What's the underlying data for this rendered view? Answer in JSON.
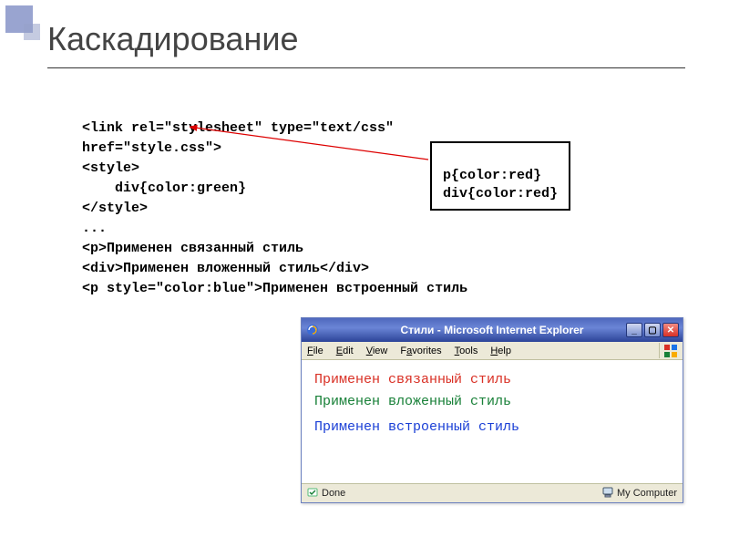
{
  "slide": {
    "title": "Каскадирование"
  },
  "code": {
    "l1": "<link rel=\"stylesheet\" type=\"text/css\"",
    "l2": "href=\"style.css\">",
    "l3": "<style>",
    "l4": "    div{color:green}",
    "l5": "</style>",
    "l6": "...",
    "l7": "<p>Применен связанный стиль",
    "l8": "<div>Применен вложенный стиль</div>",
    "l9": "<p style=\"color:blue\">Применен встроенный стиль"
  },
  "cssbox": {
    "l1": "p{color:red}",
    "l2": "div{color:red}"
  },
  "iewin": {
    "title": "Стили - Microsoft Internet Explorer",
    "menu": {
      "file": "File",
      "edit": "Edit",
      "view": "View",
      "favorites": "Favorites",
      "tools": "Tools",
      "help": "Help"
    },
    "content": {
      "line1": "Применен связанный стиль",
      "line2": "Применен вложенный стиль",
      "line3": "Применен встроенный стиль"
    },
    "status": {
      "done": "Done",
      "zone": "My Computer"
    }
  }
}
